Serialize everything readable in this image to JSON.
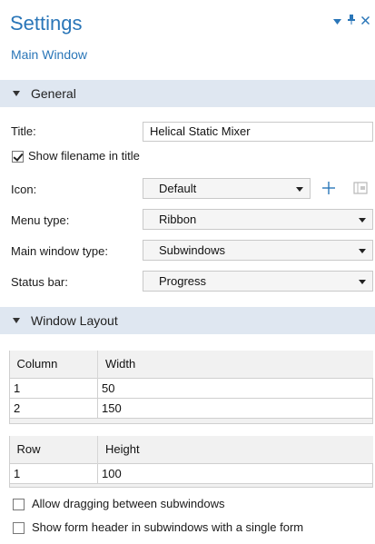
{
  "header": {
    "title": "Settings",
    "subtitle": "Main Window",
    "icons": [
      "dropdown-arrow-icon",
      "pin-icon",
      "close-icon"
    ]
  },
  "general": {
    "section_label": "General",
    "title_label": "Title:",
    "title_value": "Helical Static Mixer",
    "show_filename_label": "Show filename in title",
    "show_filename_checked": true,
    "icon_label": "Icon:",
    "icon_value": "Default",
    "menu_type_label": "Menu type:",
    "menu_type_value": "Ribbon",
    "main_window_type_label": "Main window type:",
    "main_window_type_value": "Subwindows",
    "status_bar_label": "Status bar:",
    "status_bar_value": "Progress"
  },
  "window_layout": {
    "section_label": "Window Layout",
    "columns_table": {
      "headers": [
        "Column",
        "Width"
      ],
      "rows": [
        [
          "1",
          "50"
        ],
        [
          "2",
          "150"
        ]
      ]
    },
    "rows_table": {
      "headers": [
        "Row",
        "Height"
      ],
      "rows": [
        [
          "1",
          "100"
        ]
      ]
    },
    "allow_dragging_label": "Allow dragging between subwindows",
    "allow_dragging_checked": false,
    "show_form_header_label": "Show form header in subwindows with a single form",
    "show_form_header_checked": false
  },
  "colors": {
    "accent": "#2a76b8",
    "section_bg": "#dfe7f1"
  }
}
